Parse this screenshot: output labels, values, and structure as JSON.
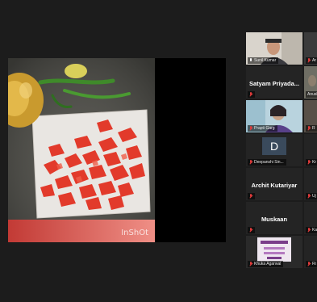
{
  "shared_screen": {
    "watermark": "InShOt"
  },
  "gallery": {
    "participants": [
      {
        "name": "Sunil Kumar",
        "display": "",
        "mic": "on",
        "has_video": true
      },
      {
        "name": "Ar",
        "display": "",
        "mic": "muted",
        "has_video": true
      },
      {
        "name": "",
        "display": "Satyam Priyada...",
        "mic": "muted",
        "has_video": false
      },
      {
        "name": "Anush",
        "display": "",
        "mic": "muted",
        "has_video": true
      },
      {
        "name": "Prapti Garg",
        "display": "",
        "mic": "muted",
        "has_video": true
      },
      {
        "name": "R",
        "display": "",
        "mic": "muted",
        "has_video": true
      },
      {
        "name": "Deepanshi Sin...",
        "display": "",
        "avatar_letter": "D",
        "mic": "muted",
        "has_video": false
      },
      {
        "name": "Kr",
        "display": "",
        "mic": "muted",
        "has_video": false
      },
      {
        "name": "",
        "display": "Archit Kutariyar",
        "mic": "muted",
        "has_video": false
      },
      {
        "name": "Uj",
        "display": "",
        "mic": "muted",
        "has_video": false
      },
      {
        "name": "",
        "display": "Muskaan",
        "mic": "muted",
        "has_video": false
      },
      {
        "name": "Ka",
        "display": "",
        "mic": "muted",
        "has_video": false
      },
      {
        "name": "Khuka Agarwal",
        "display": "",
        "mic": "muted",
        "has_video": true
      },
      {
        "name": "Ri",
        "display": "",
        "mic": "muted",
        "has_video": false
      }
    ]
  }
}
